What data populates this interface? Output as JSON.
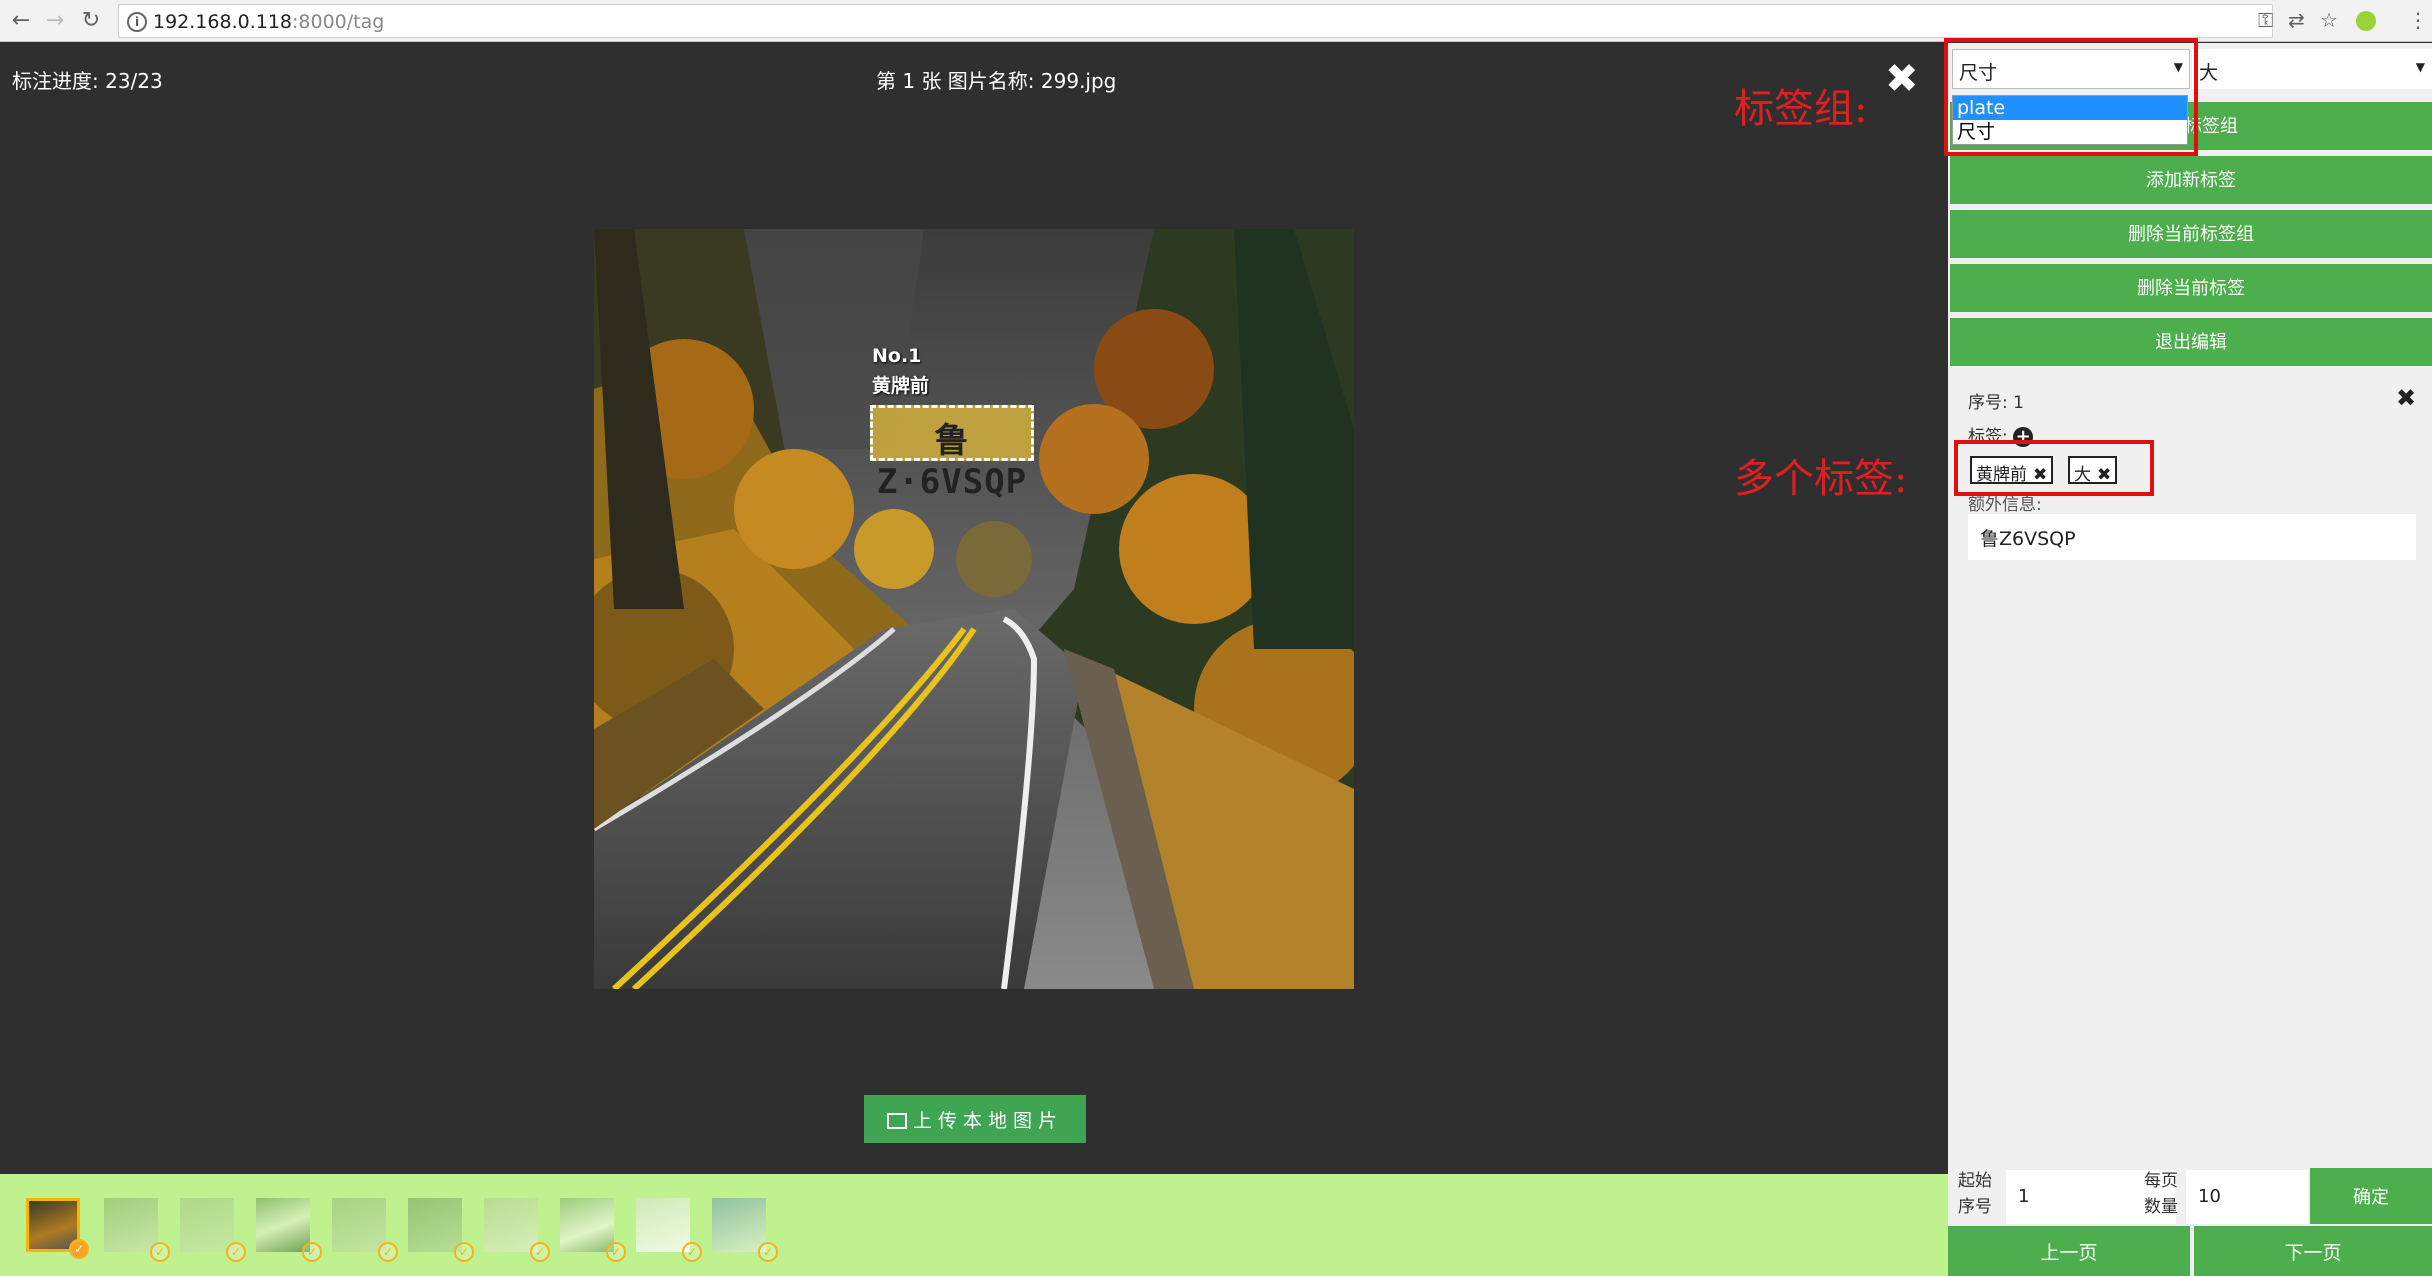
{
  "browser": {
    "url_host": "192.168.0.118",
    "url_path": ":8000/tag"
  },
  "main": {
    "progress": "标注进度: 23/23",
    "image_name": "第 1 张 图片名称: 299.jpg",
    "close": "✖",
    "bbox": {
      "no": "No.1",
      "label": "黄牌前",
      "plate_text": "鲁Z·6VSQP"
    },
    "upload_label": "上传本地图片"
  },
  "annotations": {
    "tag_group": "标签组:",
    "multi_tags": "多个标签:"
  },
  "panel": {
    "select_group": "尺寸",
    "select_tag": "大",
    "dropdown_options": [
      "plate",
      "尺寸"
    ],
    "btn_group_partial": "标签组",
    "buttons": [
      "添加新标签",
      "删除当前标签组",
      "删除当前标签",
      "退出编辑"
    ],
    "detail": {
      "seq": "序号: 1",
      "tags_label": "标签:",
      "tags": [
        "黄牌前",
        "大"
      ],
      "extra_label": "额外信息:",
      "extra_value": "鲁Z6VSQP"
    },
    "pager": {
      "start_label_1": "起始",
      "start_label_2": "序号",
      "start_value": "1",
      "per_label_1": "每页",
      "per_label_2": "数量",
      "per_value": "10",
      "confirm": "确定",
      "prev": "上一页",
      "next": "下一页"
    }
  },
  "colors": {
    "accent_green": "#4cae4c",
    "strip_green": "#bff28f",
    "annotation_red": "#e02020",
    "stage_bg": "#2f2f2f"
  }
}
